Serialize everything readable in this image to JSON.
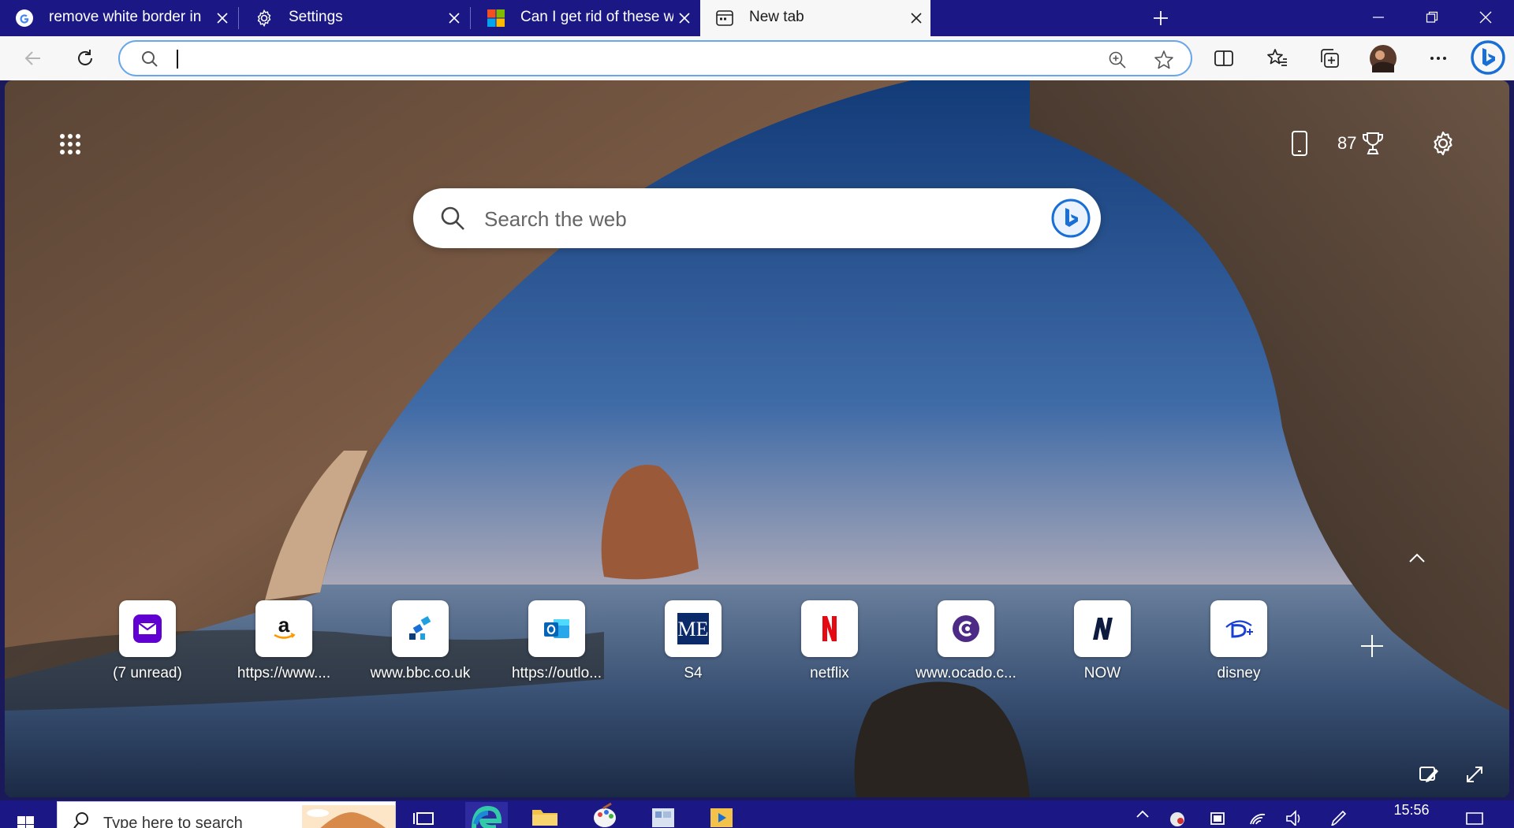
{
  "tabs": [
    {
      "title": "remove white border in edge - G",
      "favicon": "google-g-icon",
      "active": false
    },
    {
      "title": "Settings",
      "favicon": "gear-icon",
      "active": false
    },
    {
      "title": "Can I get rid of these white bord",
      "favicon": "microsoft-logo-icon",
      "active": false
    },
    {
      "title": "New tab",
      "favicon": "newtab-page-icon",
      "active": true
    }
  ],
  "toolbar": {
    "address_value": "",
    "address_placeholder": ""
  },
  "ntp": {
    "rewards_points": "87",
    "search_placeholder": "Search the web",
    "quick_links": [
      {
        "label": "(7 unread)",
        "icon": "yahoo-mail-icon"
      },
      {
        "label": "https://www....",
        "icon": "amazon-icon"
      },
      {
        "label": "www.bbc.co.uk",
        "icon": "bbc-icon"
      },
      {
        "label": "https://outlo...",
        "icon": "outlook-icon"
      },
      {
        "label": "S4",
        "icon": "s4-icon"
      },
      {
        "label": "netflix",
        "icon": "netflix-icon"
      },
      {
        "label": "www.ocado.c...",
        "icon": "ocado-icon"
      },
      {
        "label": "NOW",
        "icon": "now-tv-icon"
      },
      {
        "label": "disney",
        "icon": "disney-plus-icon"
      }
    ]
  },
  "taskbar": {
    "search_placeholder": "Type here to search",
    "time": "15:56"
  },
  "colors": {
    "frame": "#1b1885",
    "toolbar": "#f7f7f7",
    "omnibox_border": "#6aa6ea",
    "edge_blue": "#1a6fd6"
  }
}
